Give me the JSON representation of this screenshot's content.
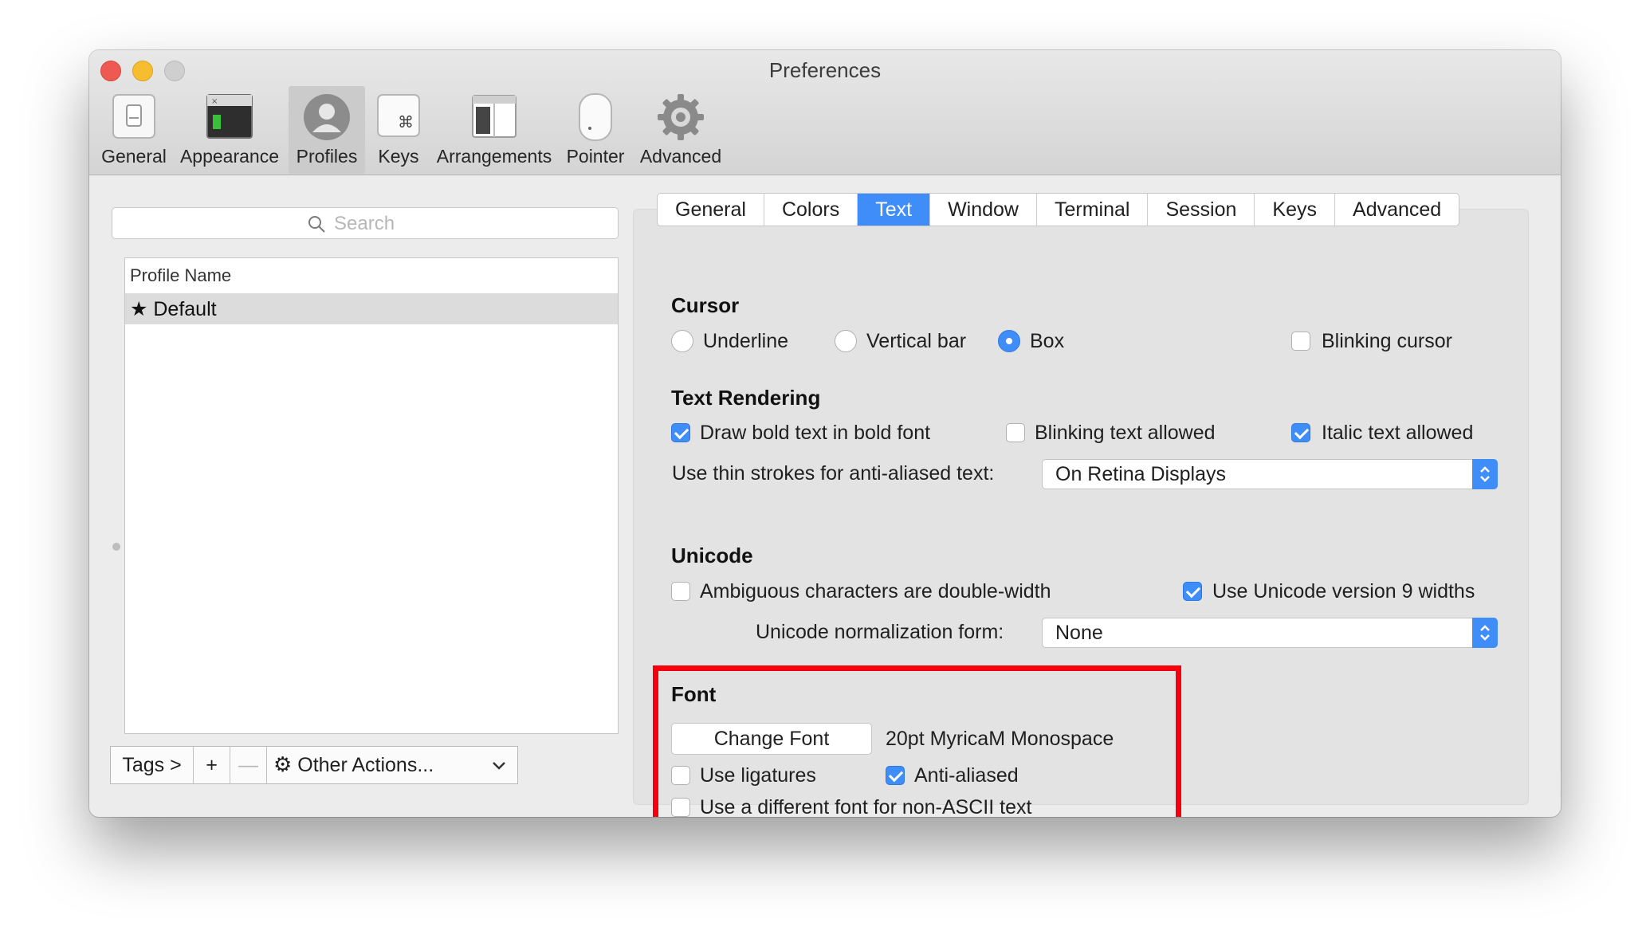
{
  "window": {
    "title": "Preferences"
  },
  "toolbar": {
    "items": [
      {
        "label": "General",
        "icon": "switch-icon",
        "selected": false
      },
      {
        "label": "Appearance",
        "icon": "window-icon",
        "selected": false
      },
      {
        "label": "Profiles",
        "icon": "user-icon",
        "selected": true
      },
      {
        "label": "Keys",
        "icon": "command-key-icon",
        "selected": false
      },
      {
        "label": "Arrangements",
        "icon": "windows-icon",
        "selected": false
      },
      {
        "label": "Pointer",
        "icon": "mouse-icon",
        "selected": false
      },
      {
        "label": "Advanced",
        "icon": "gear-icon",
        "selected": false
      }
    ]
  },
  "sidebar": {
    "search_placeholder": "Search",
    "list_header": "Profile Name",
    "profiles": [
      {
        "name": "★ Default",
        "selected": true
      }
    ],
    "bottom": {
      "tags": "Tags >",
      "add": "+",
      "remove": "—",
      "other_actions": "Other Actions..."
    }
  },
  "tabs": [
    {
      "label": "General",
      "active": false
    },
    {
      "label": "Colors",
      "active": false
    },
    {
      "label": "Text",
      "active": true
    },
    {
      "label": "Window",
      "active": false
    },
    {
      "label": "Terminal",
      "active": false
    },
    {
      "label": "Session",
      "active": false
    },
    {
      "label": "Keys",
      "active": false
    },
    {
      "label": "Advanced",
      "active": false
    }
  ],
  "cursor": {
    "title": "Cursor",
    "underline": "Underline",
    "vertical_bar": "Vertical bar",
    "box": "Box",
    "selected": "Box",
    "blinking": {
      "label": "Blinking cursor",
      "checked": false
    }
  },
  "text_rendering": {
    "title": "Text Rendering",
    "bold": {
      "label": "Draw bold text in bold font",
      "checked": true
    },
    "blinking_text": {
      "label": "Blinking text allowed",
      "checked": false
    },
    "italic": {
      "label": "Italic text allowed",
      "checked": true
    },
    "thin_strokes_label": "Use thin strokes for anti-aliased text:",
    "thin_strokes_value": "On Retina Displays"
  },
  "unicode": {
    "title": "Unicode",
    "ambiguous": {
      "label": "Ambiguous characters are double-width",
      "checked": false
    },
    "v9": {
      "label": "Use Unicode version 9 widths",
      "checked": true
    },
    "normalization_label": "Unicode normalization form:",
    "normalization_value": "None"
  },
  "font": {
    "title": "Font",
    "change_button": "Change Font",
    "current": "20pt MyricaM Monospace",
    "ligatures": {
      "label": "Use ligatures",
      "checked": false
    },
    "anti_aliased": {
      "label": "Anti-aliased",
      "checked": true
    },
    "non_ascii": {
      "label": "Use a different font for non-ASCII text",
      "checked": false
    }
  },
  "colors": {
    "accent": "#3f8df9",
    "highlight": "#f5000d"
  }
}
